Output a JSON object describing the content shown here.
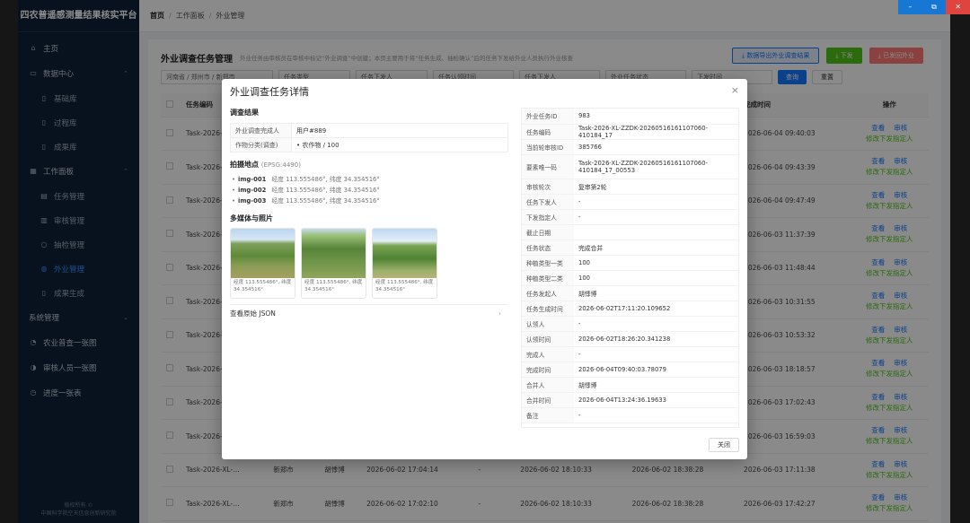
{
  "window_controls": {
    "minimize": "–",
    "maximize": "⧉",
    "close": "✕"
  },
  "sidebar": {
    "brand": "四农普遥感测量结果核实平台",
    "items": [
      {
        "label": "主页",
        "icon": "home-icon",
        "level": 0
      },
      {
        "label": "数据中心",
        "icon": "monitor-icon",
        "level": 0,
        "expanded": true
      },
      {
        "label": "基础库",
        "icon": "folder-icon",
        "level": 1
      },
      {
        "label": "过程库",
        "icon": "folder-icon",
        "level": 1
      },
      {
        "label": "成果库",
        "icon": "folder-icon",
        "level": 1
      },
      {
        "label": "工作面板",
        "icon": "panel-icon",
        "level": 0,
        "expanded": true
      },
      {
        "label": "任务管理",
        "icon": "task-icon",
        "level": 1
      },
      {
        "label": "审核管理",
        "icon": "audit-icon",
        "level": 1
      },
      {
        "label": "抽检管理",
        "icon": "search-icon",
        "level": 1
      },
      {
        "label": "外业管理",
        "icon": "globe-icon",
        "level": 1,
        "active": true
      },
      {
        "label": "成果生成",
        "icon": "folder-icon",
        "level": 1
      },
      {
        "label": "系统管理",
        "icon": "gear-icon",
        "level": 0
      },
      {
        "label": "农业普查一张图",
        "icon": "user-icon",
        "level": 0
      },
      {
        "label": "审核人员一张图",
        "icon": "users-icon",
        "level": 0
      },
      {
        "label": "进度一张表",
        "icon": "progress-icon",
        "level": 0
      }
    ],
    "footer_line1": "版权所有 ©",
    "footer_line2": "中国科学院空天信息创新研究院"
  },
  "breadcrumb": {
    "home": "首页",
    "level1": "工作面板",
    "level2": "外业管理"
  },
  "page": {
    "title": "外业调查任务管理",
    "subtitle": "外业任务由审核员在审核中标记“外业调查”中创建；本页主要用于将“任务生成、抽检确认”后的任务下发给外业人员执行外业核查",
    "btn_export": "⤓ 数据导出外业调查结果",
    "btn_dispatch": "⤓ 下发",
    "btn_return": "⤓ 已发回外业",
    "filters": {
      "region": "河南省 / 郑州市 / 新郑市",
      "f2": "任务类型",
      "f3": "任务下发人",
      "f4": "任务认领时间",
      "f5": "任务下发人",
      "f6": "外业任务状态",
      "f7": "下发时间"
    },
    "query": "查询",
    "reset": "重置",
    "columns": [
      "任务编码",
      "所属区域",
      "下发人",
      "创建时间",
      "认领人",
      "认领时间",
      "下发时间",
      "完成时间",
      "操作"
    ],
    "rows": [
      {
        "code": "Task-2026-XL-…",
        "region": "",
        "person": "",
        "created": "",
        "claimer": "",
        "claimed": "",
        "dispatched": "",
        "done": "2026-06-04 09:40:03"
      },
      {
        "code": "Task-2026-XL-…",
        "region": "",
        "person": "",
        "created": "",
        "claimer": "",
        "claimed": "",
        "dispatched": "",
        "done": "2026-06-04 09:43:39"
      },
      {
        "code": "Task-2026-XL-…",
        "region": "",
        "person": "",
        "created": "",
        "claimer": "",
        "claimed": "",
        "dispatched": "",
        "done": "2026-06-04 09:47:49"
      },
      {
        "code": "Task-2026-XL-…",
        "region": "",
        "person": "",
        "created": "",
        "claimer": "",
        "claimed": "",
        "dispatched": "",
        "done": "2026-06-03 11:37:39"
      },
      {
        "code": "Task-2026-XL-…",
        "region": "",
        "person": "",
        "created": "",
        "claimer": "",
        "claimed": "",
        "dispatched": "",
        "done": "2026-06-03 11:48:44"
      },
      {
        "code": "Task-2026-XL-…",
        "region": "",
        "person": "",
        "created": "",
        "claimer": "",
        "claimed": "",
        "dispatched": "",
        "done": "2026-06-03 10:31:55"
      },
      {
        "code": "Task-2026-XL-…",
        "region": "",
        "person": "",
        "created": "",
        "claimer": "",
        "claimed": "",
        "dispatched": "",
        "done": "2026-06-03 10:53:32"
      },
      {
        "code": "Task-2026-XL-…",
        "region": "",
        "person": "",
        "created": "",
        "claimer": "",
        "claimed": "",
        "dispatched": "",
        "done": "2026-06-03 18:18:57"
      },
      {
        "code": "Task-2026-XL-…",
        "region": "",
        "person": "",
        "created": "",
        "claimer": "",
        "claimed": "",
        "dispatched": "",
        "done": "2026-06-03 17:02:43"
      },
      {
        "code": "Task-2026-XL-…",
        "region": "",
        "person": "",
        "created": "",
        "claimer": "",
        "claimed": "",
        "dispatched": "",
        "done": "2026-06-03 16:59:03"
      },
      {
        "code": "Task-2026-XL-…",
        "region": "新郑市",
        "person": "胡悸博",
        "created": "2026-06-02 17:04:14",
        "claimer": "-",
        "claimed": "2026-06-02 18:10:33",
        "dispatched": "2026-06-02 18:38:28",
        "done": "2026-06-03 17:11:38"
      },
      {
        "code": "Task-2026-XL-…",
        "region": "新郑市",
        "person": "胡悸博",
        "created": "2026-06-02 17:02:10",
        "claimer": "-",
        "claimed": "2026-06-02 18:10:33",
        "dispatched": "2026-06-02 18:38:28",
        "done": "2026-06-03 17:42:27"
      }
    ],
    "op_view": "查看",
    "op_audit": "审核",
    "op_change": "修改下发指定人"
  },
  "modal": {
    "title": "外业调查任务详情",
    "close_icon": "×",
    "result_section": "调查结果",
    "result_rows": [
      {
        "k": "外业调查完成人",
        "v": "用户#889"
      },
      {
        "k": "作物分类(调查)",
        "v": "• 农作物 / 100"
      }
    ],
    "location_section": "拍摄地点",
    "epsg": "(EPSG:4490)",
    "points": [
      {
        "id": "img-001",
        "coord": "经度 113.555486°, 纬度 34.354516°"
      },
      {
        "id": "img-002",
        "coord": "经度 113.555486°, 纬度 34.354516°"
      },
      {
        "id": "img-003",
        "coord": "经度 113.555486°, 纬度 34.354516°"
      }
    ],
    "media_section": "多媒体与照片",
    "photos": [
      {
        "caption": "经度 113.555486°, 纬度 34.354516°"
      },
      {
        "caption": "经度 113.555486°, 纬度 34.354516°"
      },
      {
        "caption": "经度 113.555486°, 纬度 34.354516°"
      }
    ],
    "raw_json": "查看原始 JSON",
    "details": [
      {
        "k": "外业任务ID",
        "v": "983"
      },
      {
        "k": "任务编码",
        "v": "Task-2026-XL-ZZDK-20260516161107060-410184_17"
      },
      {
        "k": "当前轮审核ID",
        "v": "385766"
      },
      {
        "k": "要素唯一码",
        "v": "Task-2026-XL-ZZDK-20260516161107060-410184_17_00553"
      },
      {
        "k": "审核轮次",
        "v": "复审第2轮"
      },
      {
        "k": "任务下发人",
        "v": "-"
      },
      {
        "k": "下发指定人",
        "v": "-"
      },
      {
        "k": "截止日期",
        "v": ""
      },
      {
        "k": "任务状态",
        "v": "完成合并"
      },
      {
        "k": "种植类型一类",
        "v": "100"
      },
      {
        "k": "种植类型二类",
        "v": "100"
      },
      {
        "k": "任务发起人",
        "v": "胡悸博"
      },
      {
        "k": "任务生成时间",
        "v": "2026-06-02T17:11:20.109652"
      },
      {
        "k": "认领人",
        "v": "-"
      },
      {
        "k": "认领时间",
        "v": "2026-06-02T18:26:20.341238"
      },
      {
        "k": "完成人",
        "v": "-"
      },
      {
        "k": "完成时间",
        "v": "2026-06-04T09:40:03.78079"
      },
      {
        "k": "合并人",
        "v": "胡悸博"
      },
      {
        "k": "合并时间",
        "v": "2026-06-04T13:24:36.19633"
      },
      {
        "k": "备注",
        "v": "-"
      }
    ],
    "close_btn": "关闭"
  }
}
